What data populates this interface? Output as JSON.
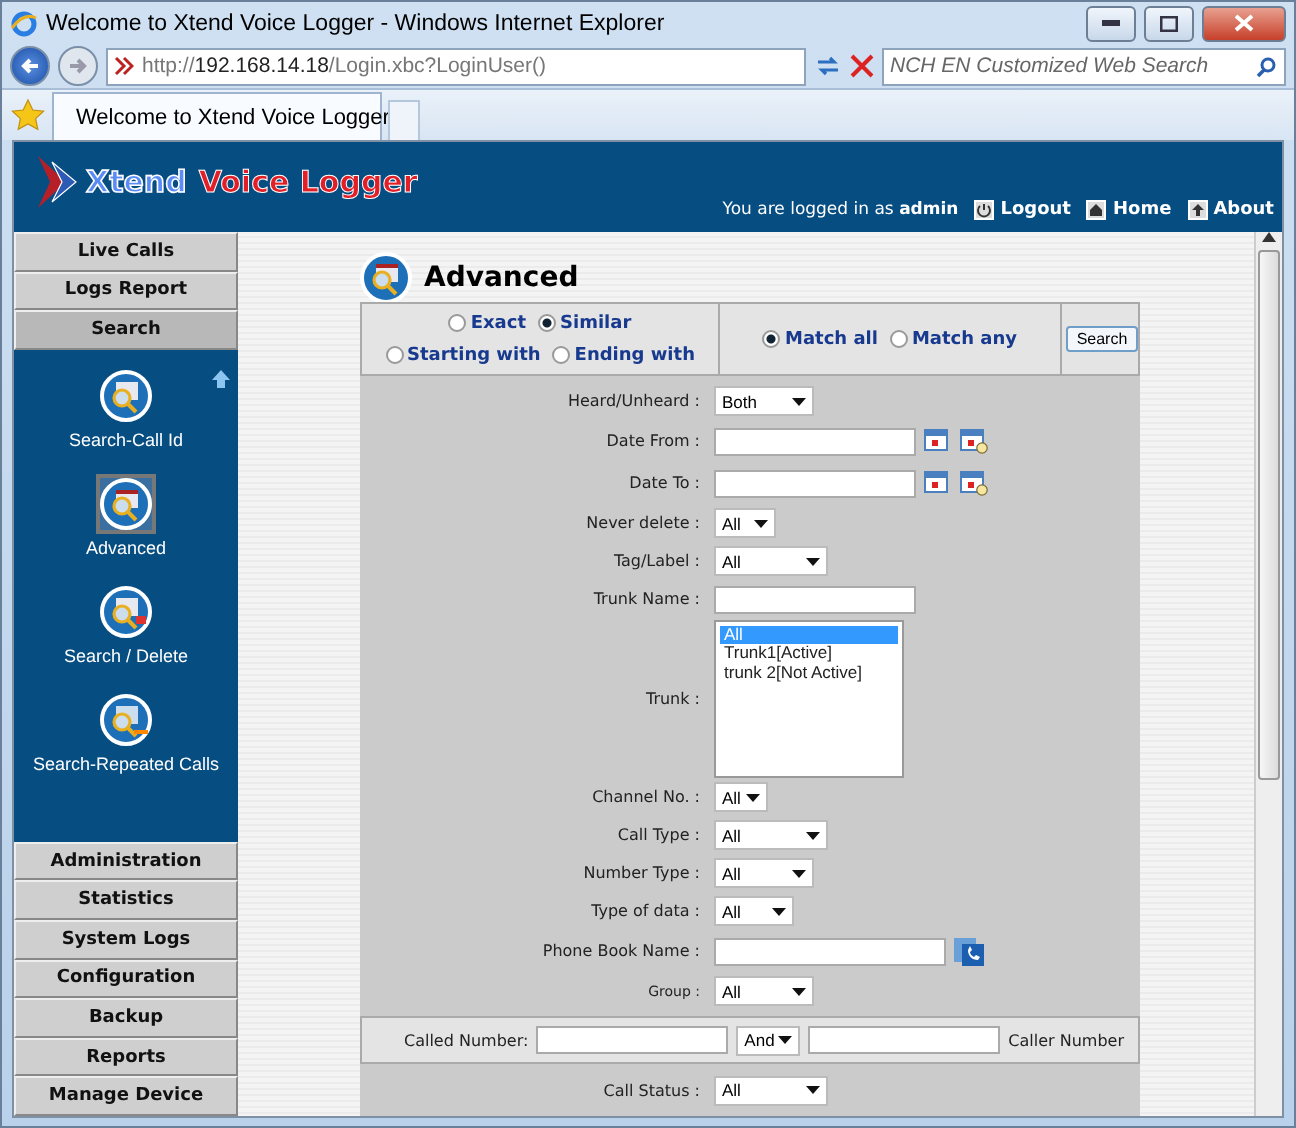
{
  "window": {
    "title": "Welcome to Xtend Voice Logger - Windows Internet Explorer"
  },
  "address": {
    "scheme": "http://",
    "host": "192.168.14.18",
    "path": "/Login.xbc?LoginUser()"
  },
  "web_search": {
    "placeholder": "NCH EN Customized Web Search"
  },
  "tab": {
    "title": "Welcome to Xtend Voice Logger"
  },
  "header": {
    "logo_first": "Xtend",
    "logo_second": "Voice Logger",
    "login_text": "You are logged in as **admin**",
    "links": [
      {
        "label": "Logout",
        "kind": "logout"
      },
      {
        "label": "Home",
        "kind": "home"
      },
      {
        "label": "About",
        "kind": "about"
      }
    ]
  },
  "sidebar": {
    "top_items": [
      {
        "label": "Live Calls",
        "selected": false
      },
      {
        "label": "Logs Report",
        "selected": false
      },
      {
        "label": "Search",
        "selected": true
      }
    ],
    "sub_items": [
      {
        "label": "Search-Call Id",
        "selected": false
      },
      {
        "label": "Advanced",
        "selected": true
      },
      {
        "label": "Search / Delete",
        "selected": false
      },
      {
        "label": "Search-Repeated Calls",
        "selected": false
      }
    ],
    "bottom_items": [
      {
        "label": "Administration",
        "selected": false
      },
      {
        "label": "Statistics",
        "selected": false
      },
      {
        "label": "System Logs",
        "selected": false
      },
      {
        "label": "Configuration",
        "selected": false
      },
      {
        "label": "Backup",
        "selected": false
      },
      {
        "label": "Reports",
        "selected": false
      },
      {
        "label": "Manage Device",
        "selected": false
      }
    ]
  },
  "form": {
    "title": "Advanced",
    "match_options": [
      {
        "label": "Exact",
        "selected": false
      },
      {
        "label": "Similar",
        "selected": true
      },
      {
        "label": "Starting with",
        "selected": false
      },
      {
        "label": "Ending with",
        "selected": false
      }
    ],
    "mode_options": [
      {
        "label": "Match all",
        "selected": true
      },
      {
        "label": "Match any",
        "selected": false
      }
    ],
    "search_button": "Search",
    "fields": [
      {
        "kind": "select",
        "label": "Heard/Unheard :",
        "value": "Both"
      },
      {
        "kind": "date",
        "label": "Date From :"
      },
      {
        "kind": "date",
        "label": "Date To :"
      },
      {
        "kind": "select",
        "label": "Never delete :",
        "value": "All"
      },
      {
        "kind": "select",
        "label": "Tag/Label :",
        "value": "All"
      },
      {
        "kind": "text",
        "label": "Trunk Name :"
      },
      {
        "kind": "list",
        "label": "Trunk :",
        "options": [
          {
            "label": "All",
            "selected": true
          },
          {
            "label": "Trunk1[Active]",
            "selected": false
          },
          {
            "label": "trunk 2[Not Active]",
            "selected": false
          }
        ]
      },
      {
        "kind": "select",
        "label": "Channel No. :",
        "value": "All"
      },
      {
        "kind": "select",
        "label": "Call Type :",
        "value": "All"
      },
      {
        "kind": "select",
        "label": "Number Type :",
        "value": "All"
      },
      {
        "kind": "select",
        "label": "Type of data :",
        "value": "All"
      },
      {
        "kind": "phonebook",
        "label": "Phone Book Name :"
      },
      {
        "kind": "select",
        "label": "Group :",
        "value": "All",
        "small": true
      }
    ],
    "called": {
      "label": "Called Number:",
      "operator": "And",
      "caller_label": "Caller Number"
    },
    "call_status": {
      "label": "Call Status :",
      "value": "All"
    }
  }
}
